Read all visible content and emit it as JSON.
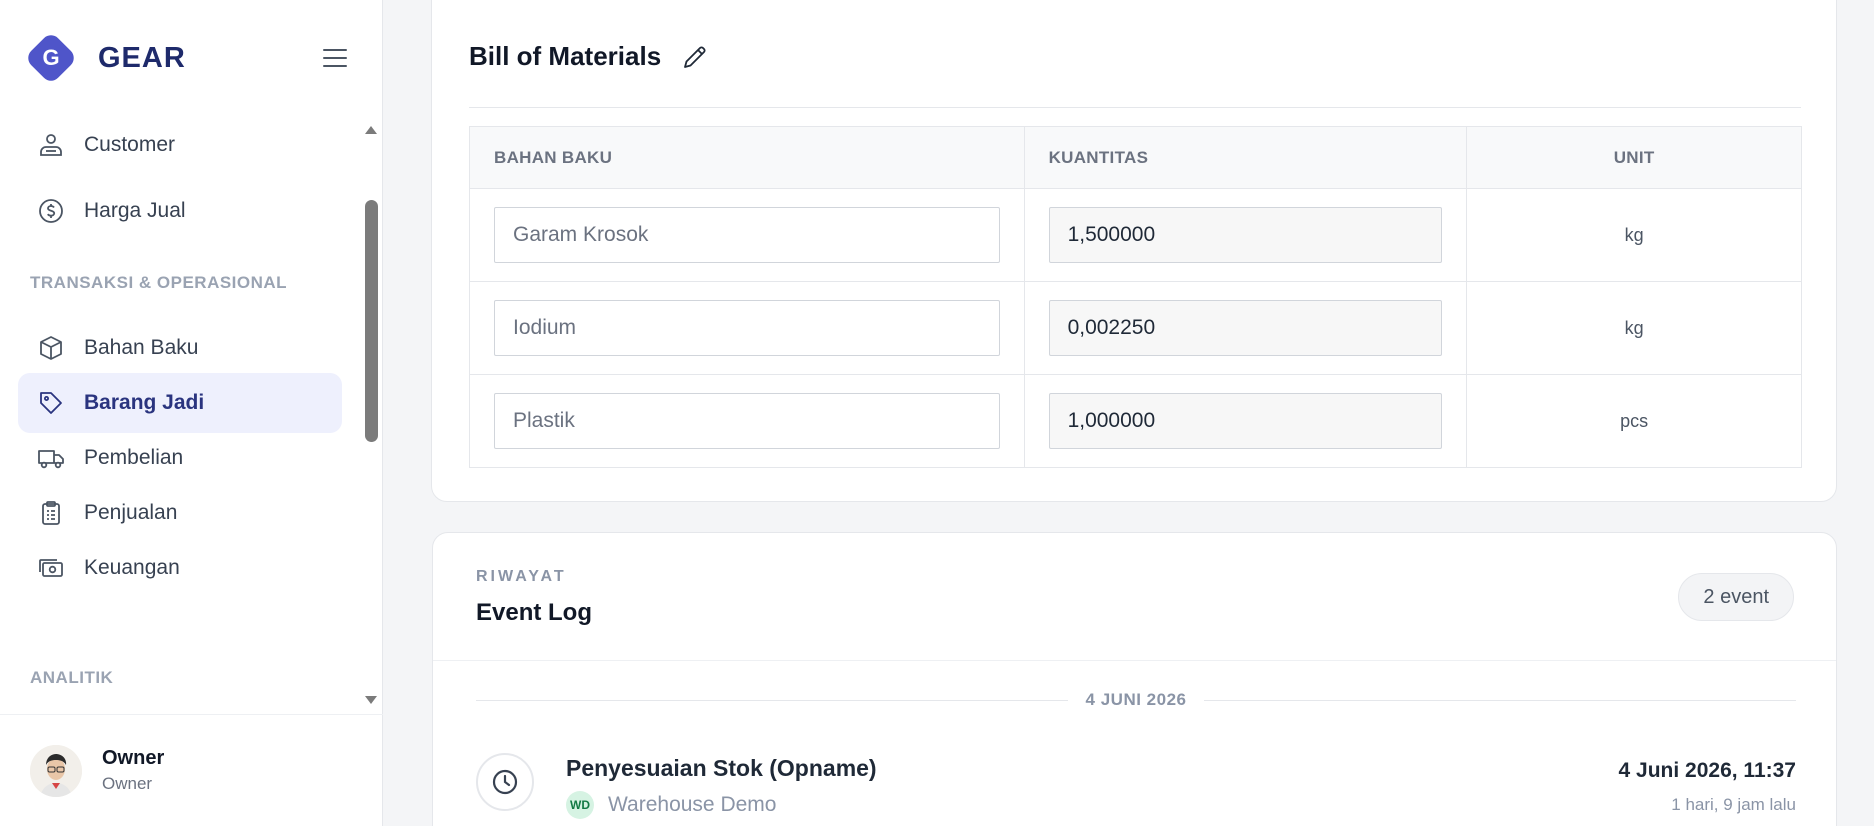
{
  "app": {
    "brand": "GEAR",
    "logo_letter": "G"
  },
  "sidebar": {
    "items": [
      {
        "label": "Customer",
        "icon": "customer-icon"
      },
      {
        "label": "Harga Jual",
        "icon": "dollar-icon"
      },
      {
        "label": "Bahan Baku",
        "icon": "box-icon"
      },
      {
        "label": "Barang Jadi",
        "icon": "tag-icon",
        "active": true
      },
      {
        "label": "Pembelian",
        "icon": "truck-icon"
      },
      {
        "label": "Penjualan",
        "icon": "clipboard-icon"
      },
      {
        "label": "Keuangan",
        "icon": "cash-icon"
      }
    ],
    "sections": [
      "TRANSAKSI & OPERASIONAL",
      "ANALITIK"
    ]
  },
  "user": {
    "name": "Owner",
    "role": "Owner"
  },
  "bom": {
    "title": "Bill of Materials",
    "headers": [
      "BAHAN BAKU",
      "KUANTITAS",
      "UNIT"
    ],
    "rows": [
      {
        "material": "Garam Krosok",
        "quantity": "1,500000",
        "unit": "kg"
      },
      {
        "material": "Iodium",
        "quantity": "0,002250",
        "unit": "kg"
      },
      {
        "material": "Plastik",
        "quantity": "1,000000",
        "unit": "pcs"
      }
    ]
  },
  "events": {
    "kicker": "RIWAYAT",
    "title": "Event Log",
    "count_badge": "2 event",
    "date_label": "4 JUNI 2026",
    "items": [
      {
        "name": "Penyesuaian Stok (Opname)",
        "warehouse_initials": "WD",
        "warehouse": "Warehouse Demo",
        "time": "4 Juni 2026, 11:37",
        "ago": "1 hari, 9 jam lalu"
      }
    ]
  },
  "colors": {
    "accent": "#4f55c9",
    "brand_text": "#1e2a6b",
    "active_bg": "#eef0fd"
  }
}
